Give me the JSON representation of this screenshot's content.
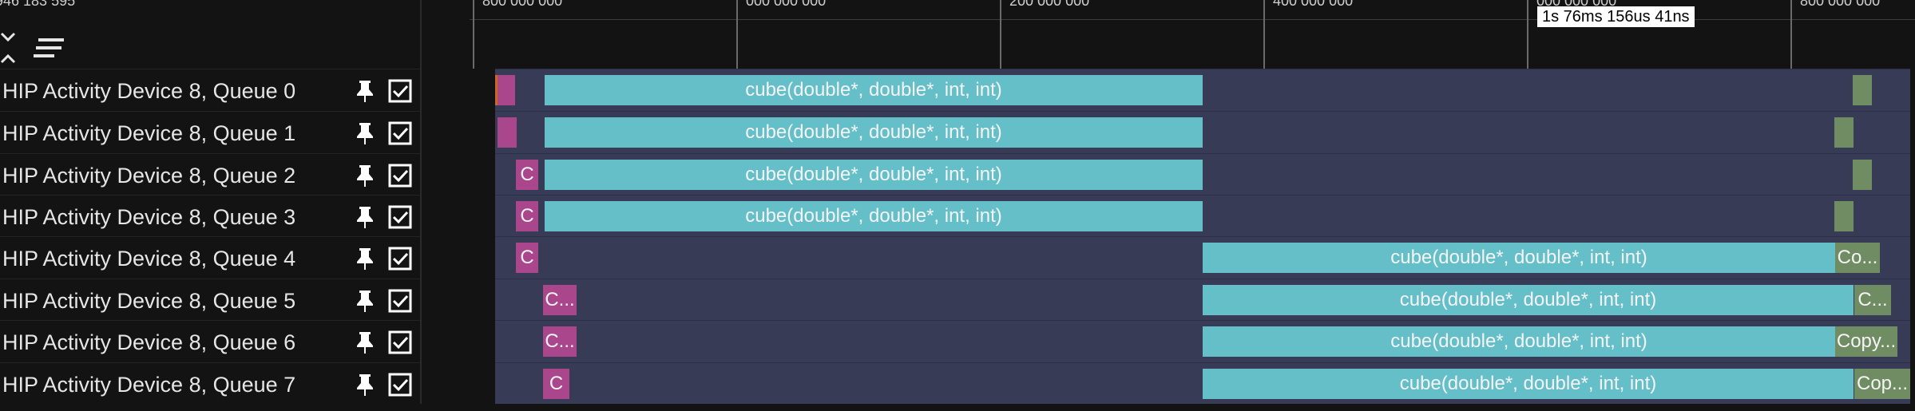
{
  "ruler": {
    "left_label": "946 183 595",
    "ticks": [
      "800 000 000",
      "000 000 000",
      "200 000 000",
      "400 000 000",
      "000 000 000",
      "800 000 000"
    ],
    "cursor_readout": "1s 76ms 156us 41ns"
  },
  "icons": {
    "collapse": "collapse-all-icon",
    "sort": "sort-lines-icon",
    "pin": "pin-icon",
    "checkbox": "checkbox-checked-icon"
  },
  "colors": {
    "kernel": "#65bfc8",
    "small_op": "#a9468c",
    "copy": "#6f8c63",
    "marker": "#c8691d",
    "timeline_bg": "#373b55"
  },
  "tracks": [
    {
      "label": "HIP Activity Device 8, Queue 0",
      "events": [
        {
          "kind": "marker",
          "text": ""
        },
        {
          "kind": "small",
          "text": ""
        },
        {
          "kind": "kernel",
          "text": "cube(double*, double*, int, int)"
        },
        {
          "kind": "copy",
          "text": ""
        }
      ]
    },
    {
      "label": "HIP Activity Device 8, Queue 1",
      "events": [
        {
          "kind": "small",
          "text": ""
        },
        {
          "kind": "kernel",
          "text": "cube(double*, double*, int, int)"
        },
        {
          "kind": "copy",
          "text": ""
        }
      ]
    },
    {
      "label": "HIP Activity Device 8, Queue 2",
      "events": [
        {
          "kind": "small",
          "text": "C"
        },
        {
          "kind": "kernel",
          "text": "cube(double*, double*, int, int)"
        },
        {
          "kind": "copy",
          "text": ""
        }
      ]
    },
    {
      "label": "HIP Activity Device 8, Queue 3",
      "events": [
        {
          "kind": "small",
          "text": "C"
        },
        {
          "kind": "kernel",
          "text": "cube(double*, double*, int, int)"
        },
        {
          "kind": "copy",
          "text": ""
        }
      ]
    },
    {
      "label": "HIP Activity Device 8, Queue 4",
      "events": [
        {
          "kind": "small",
          "text": "C"
        },
        {
          "kind": "kernel",
          "text": "cube(double*, double*, int, int)"
        },
        {
          "kind": "copy",
          "text": "Co..."
        }
      ]
    },
    {
      "label": "HIP Activity Device 8, Queue 5",
      "events": [
        {
          "kind": "small",
          "text": "C..."
        },
        {
          "kind": "kernel",
          "text": "cube(double*, double*, int, int)"
        },
        {
          "kind": "copy",
          "text": "C..."
        }
      ]
    },
    {
      "label": "HIP Activity Device 8, Queue 6",
      "events": [
        {
          "kind": "small",
          "text": "C..."
        },
        {
          "kind": "kernel",
          "text": "cube(double*, double*, int, int)"
        },
        {
          "kind": "copy",
          "text": "Copy..."
        }
      ]
    },
    {
      "label": "HIP Activity Device 8, Queue 7",
      "events": [
        {
          "kind": "small",
          "text": "C"
        },
        {
          "kind": "kernel",
          "text": "cube(double*, double*, int, int)"
        },
        {
          "kind": "copy",
          "text": "Cop..."
        }
      ]
    }
  ]
}
